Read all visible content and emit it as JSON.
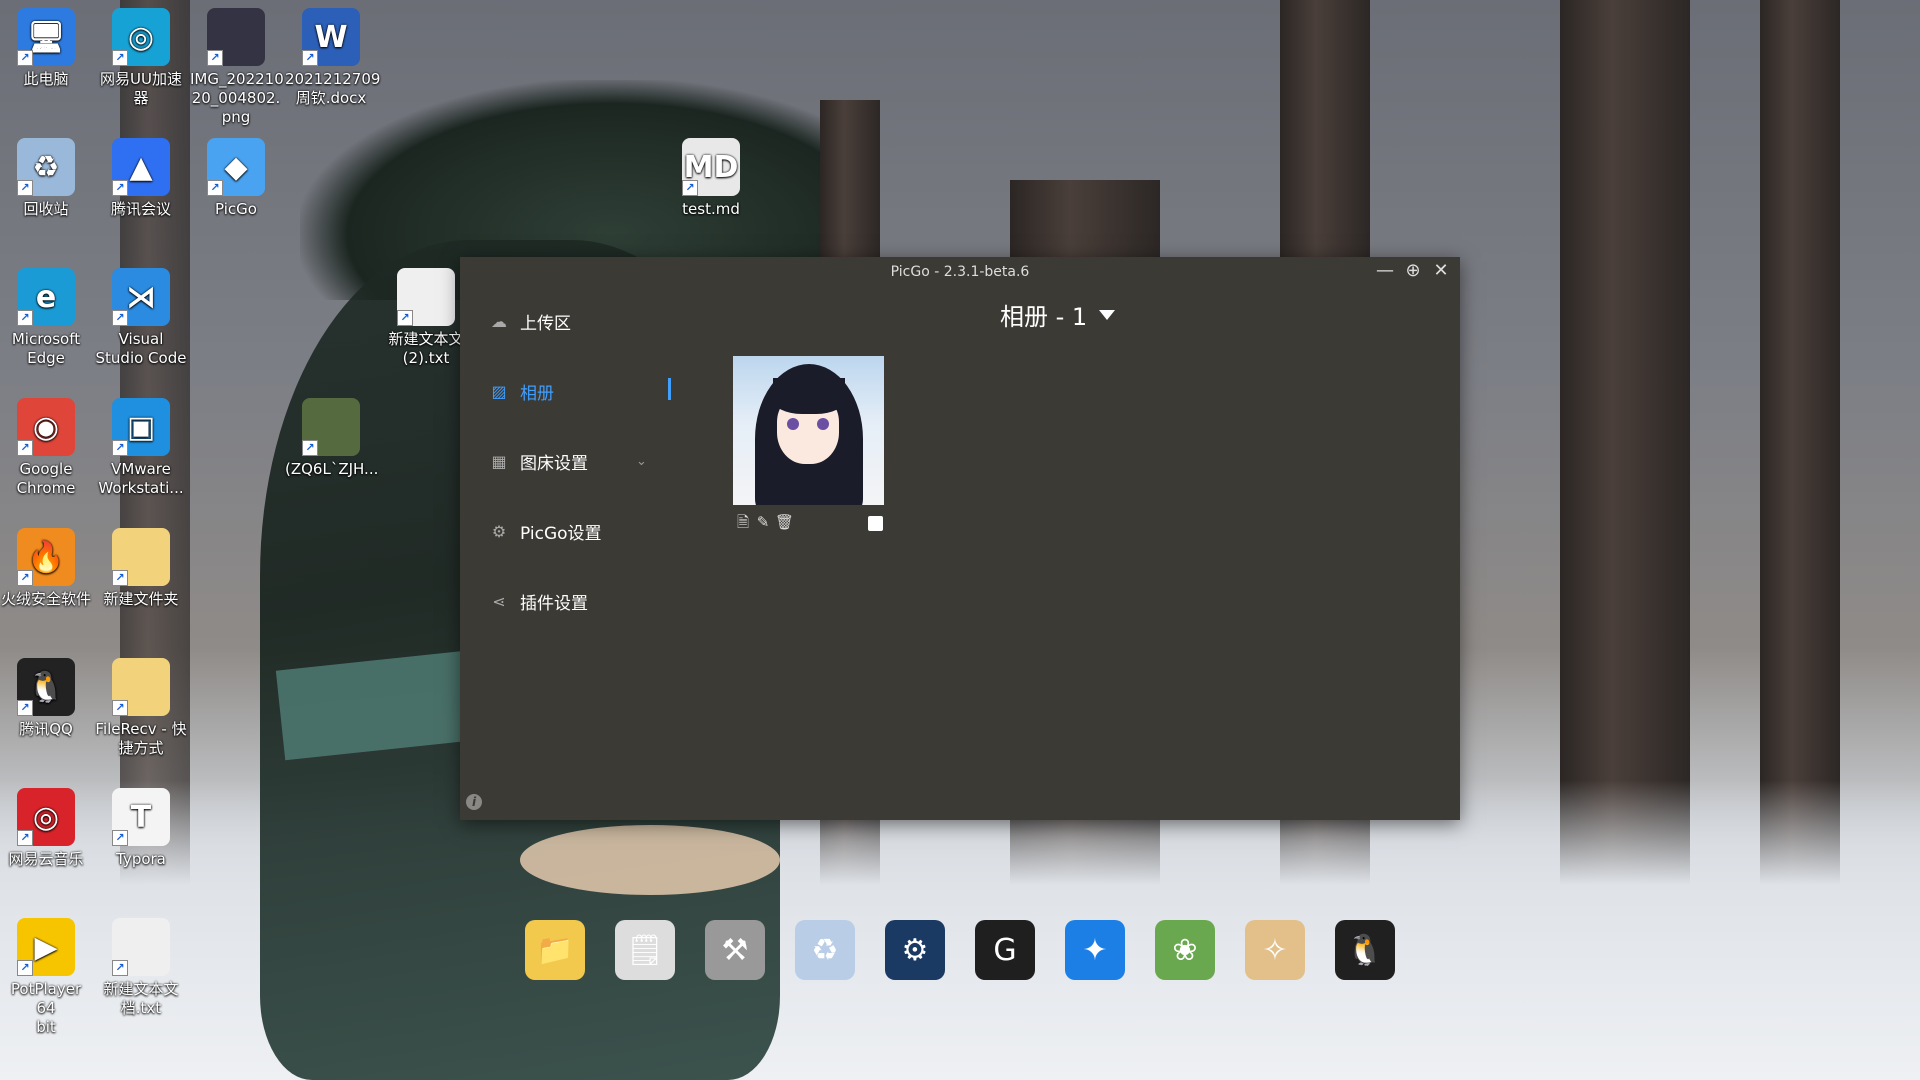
{
  "desktop": {
    "icons": [
      {
        "label": "此电脑",
        "glyph": "🖥",
        "color": "#2d7be0"
      },
      {
        "label": "网易UU加速\n器",
        "glyph": "◎",
        "color": "#17a2d6"
      },
      {
        "label": "IMG_202210\n20_004802.\npng",
        "glyph": "",
        "color": "#333344"
      },
      {
        "label": "2021212709\n周钦.docx",
        "glyph": "W",
        "color": "#2b5fb8"
      },
      {
        "label": "回收站",
        "glyph": "♻",
        "color": "#9ab8d9"
      },
      {
        "label": "腾讯会议",
        "glyph": "▲",
        "color": "#2f6ff2"
      },
      {
        "label": "PicGo",
        "glyph": "◆",
        "color": "#4aa3f0"
      },
      {
        "label": "test.md",
        "glyph": "MD",
        "color": "#e8e8e8"
      },
      {
        "label": "Microsoft\nEdge",
        "glyph": "e",
        "color": "#1b9bd6"
      },
      {
        "label": "Visual\nStudio Code",
        "glyph": "⋊",
        "color": "#2a8be0"
      },
      {
        "label": "新建文本文\n(2).txt",
        "glyph": "",
        "color": "#efefef"
      },
      {
        "label": "Google\nChrome",
        "glyph": "◉",
        "color": "#e0453a"
      },
      {
        "label": "VMware\nWorkstati...",
        "glyph": "▣",
        "color": "#1f8fe0"
      },
      {
        "label": "(ZQ6L`ZJH...",
        "glyph": "",
        "color": "#556b3f"
      },
      {
        "label": "火绒安全软件",
        "glyph": "🔥",
        "color": "#f08b1f"
      },
      {
        "label": "新建文件夹",
        "glyph": "",
        "color": "#f2d27a"
      },
      {
        "label": "腾讯QQ",
        "glyph": "🐧",
        "color": "#222222"
      },
      {
        "label": "FileRecv - 快\n捷方式",
        "glyph": "",
        "color": "#f2d27a"
      },
      {
        "label": "网易云音乐",
        "glyph": "◎",
        "color": "#d8232a"
      },
      {
        "label": "Typora",
        "glyph": "T",
        "color": "#f4f4f4"
      },
      {
        "label": "PotPlayer 64\nbit",
        "glyph": "▶",
        "color": "#f7c500"
      },
      {
        "label": "新建文本文\n档.txt",
        "glyph": "",
        "color": "#efefef"
      }
    ],
    "dock": [
      {
        "name": "folder",
        "glyph": "📁",
        "color": "#f2c94c"
      },
      {
        "name": "notepad",
        "glyph": "🗒",
        "color": "#dddddd"
      },
      {
        "name": "tools",
        "glyph": "⚒",
        "color": "#999999"
      },
      {
        "name": "recycle-bin",
        "glyph": "♻",
        "color": "#b9cde6"
      },
      {
        "name": "steam",
        "glyph": "⚙",
        "color": "#1b3a63"
      },
      {
        "name": "game-app",
        "glyph": "G",
        "color": "#1f1f1f"
      },
      {
        "name": "battle-net",
        "glyph": "✦",
        "color": "#1c7fe6"
      },
      {
        "name": "plants-game",
        "glyph": "❀",
        "color": "#6aa84f"
      },
      {
        "name": "genshin",
        "glyph": "✧",
        "color": "#e3c08a"
      },
      {
        "name": "qq",
        "glyph": "🐧",
        "color": "#202020"
      }
    ]
  },
  "window": {
    "title": "PicGo - 2.3.1-beta.6",
    "controls": {
      "minimize": "—",
      "maximize": "⊕",
      "close": "✕"
    },
    "menu": {
      "upload": "上传区",
      "gallery": "相册",
      "picbed": "图床设置",
      "settings": "PicGo设置",
      "plugins": "插件设置"
    },
    "album_title": "相册 - 1",
    "info": "i",
    "accent": "#409eff"
  }
}
